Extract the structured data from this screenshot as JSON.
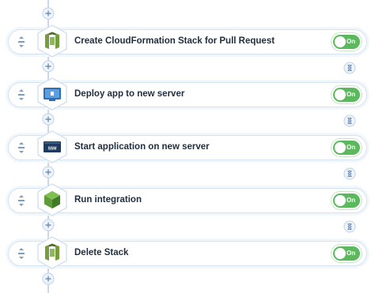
{
  "steps": [
    {
      "label": "Create CloudFormation Stack for Pull Request",
      "icon": "cloudformation-icon",
      "toggle": "On",
      "enabled": true
    },
    {
      "label": "Deploy app to new server",
      "icon": "server-deploy-icon",
      "toggle": "On",
      "enabled": true
    },
    {
      "label": "Start application on new server",
      "icon": "ssm-icon",
      "toggle": "On",
      "enabled": true
    },
    {
      "label": "Run integration",
      "icon": "integration-cube-icon",
      "toggle": "On",
      "enabled": true
    },
    {
      "label": "Delete Stack",
      "icon": "cloudformation-icon",
      "toggle": "On",
      "enabled": true
    }
  ],
  "ssm_badge": "SSM",
  "colors": {
    "accent": "#5cb85c",
    "card_border": "#d4e2f2",
    "connector": "#c9d8ea",
    "cloudformation": "#6b8e23",
    "text": "#1f2d3d"
  }
}
